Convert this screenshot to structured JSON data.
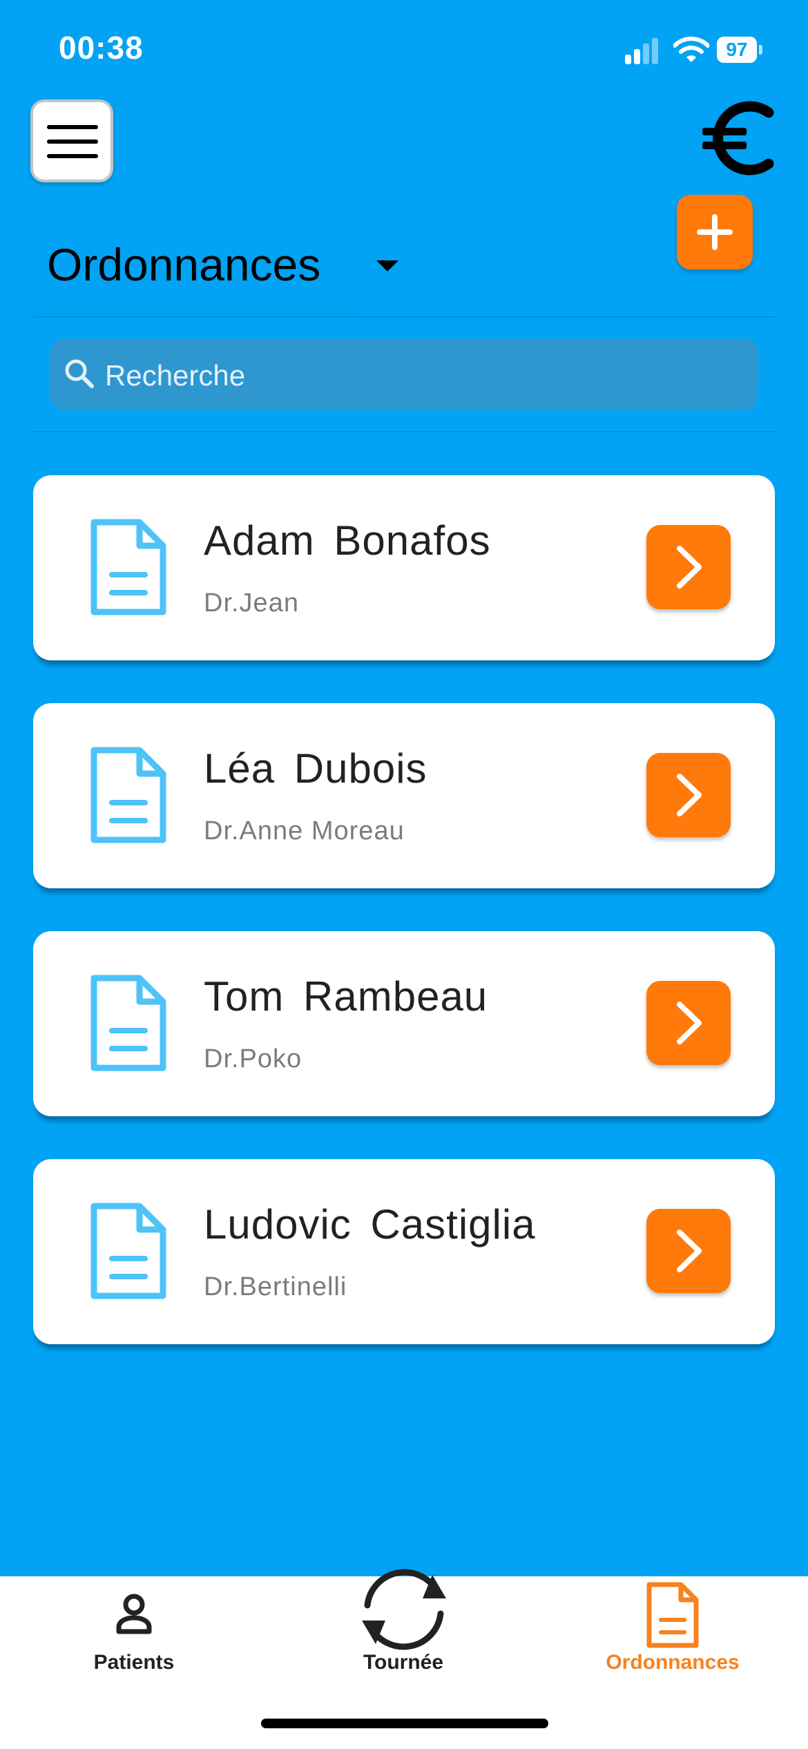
{
  "status_bar": {
    "time": "00:38",
    "battery": "97"
  },
  "header": {
    "menu_icon": "hamburger-menu-icon",
    "euro_icon": "euro-icon"
  },
  "selector": {
    "value": "Ordonnances"
  },
  "add_button_icon": "plus-icon",
  "search": {
    "placeholder": "Recherche"
  },
  "prescriptions": [
    {
      "patient": "Adam  Bonafos",
      "doctor": "Dr.Jean"
    },
    {
      "patient": "Léa  Dubois",
      "doctor": "Dr.Anne Moreau"
    },
    {
      "patient": "Tom  Rambeau",
      "doctor": "Dr.Poko"
    },
    {
      "patient": "Ludovic  Castiglia",
      "doctor": "Dr.Bertinelli"
    }
  ],
  "tabs": [
    {
      "label": "Patients",
      "icon": "person-icon"
    },
    {
      "label": "Tournée",
      "icon": "sync-icon"
    },
    {
      "label": "Ordonnances",
      "icon": "document-icon",
      "active": true
    }
  ],
  "colors": {
    "background": "#02A3F4",
    "accent": "#FF7A0A",
    "icon_blue": "#4DC3F7",
    "tab_inactive": "#222222"
  }
}
